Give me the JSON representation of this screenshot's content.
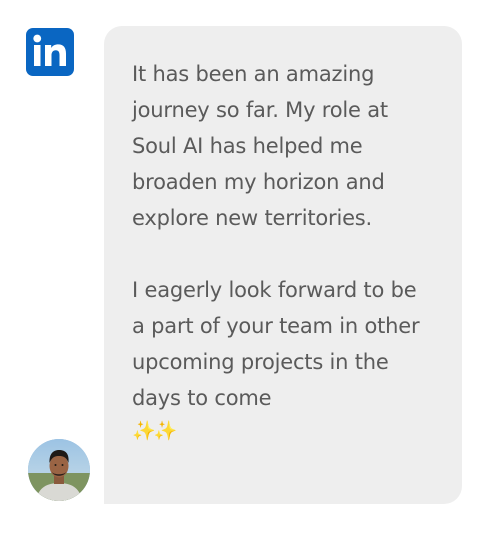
{
  "testimonial": {
    "source_icon": "linkedin-icon",
    "message": "It has been an amazing\njourney so far. My role at\nSoul AI has helped me\nbroaden my horizon and\nexplore new territories.\n\nI eagerly look forward to be\na part of your team in other\nupcoming projects in the\ndays to come",
    "emoji": "✨✨",
    "avatar_icon": "user-avatar-photo"
  },
  "colors": {
    "linkedin_brand": "#0a66c2",
    "bubble_background": "#eeeeee",
    "message_text": "#5a5a5a"
  }
}
